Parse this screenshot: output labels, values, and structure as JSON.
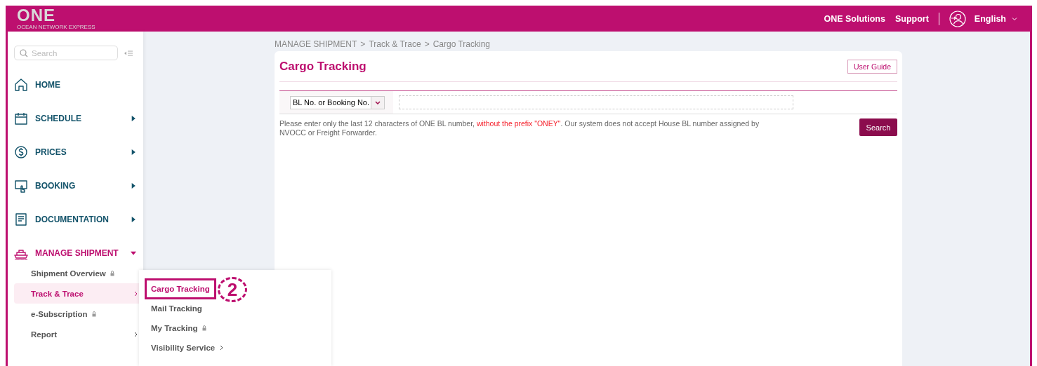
{
  "header": {
    "logo": "ONE",
    "logo_tagline": "OCEAN NETWORK EXPRESS",
    "links": [
      "ONE Solutions",
      "Support"
    ],
    "language": "English"
  },
  "sidebar": {
    "search": {
      "placeholder": "Search"
    },
    "items": [
      {
        "label": "HOME",
        "selected": false,
        "expandable": false,
        "expanded": false
      },
      {
        "label": "SCHEDULE",
        "selected": false,
        "expandable": true,
        "expanded": false
      },
      {
        "label": "PRICES",
        "selected": false,
        "expandable": true,
        "expanded": false
      },
      {
        "label": "BOOKING",
        "selected": false,
        "expandable": true,
        "expanded": false
      },
      {
        "label": "DOCUMENTATION",
        "selected": false,
        "expandable": true,
        "expanded": false
      },
      {
        "label": "MANAGE SHIPMENT",
        "selected": true,
        "expandable": true,
        "expanded": true,
        "children": [
          {
            "label": "Shipment Overview",
            "selected": false,
            "locked": true,
            "submenu": false
          },
          {
            "label": "Track & Trace",
            "selected": true,
            "locked": false,
            "submenu": true
          },
          {
            "label": "e-Subscription",
            "selected": false,
            "locked": true,
            "submenu": false
          },
          {
            "label": "Report",
            "selected": false,
            "locked": false,
            "submenu": true
          }
        ]
      }
    ]
  },
  "flyout": {
    "items": [
      {
        "label": "Cargo Tracking",
        "selected": true,
        "locked": false,
        "submenu": false,
        "highlighted": true
      },
      {
        "label": "Mail Tracking",
        "selected": false,
        "locked": false,
        "submenu": false,
        "highlighted": false
      },
      {
        "label": "My Tracking",
        "selected": false,
        "locked": true,
        "submenu": false,
        "highlighted": false
      },
      {
        "label": "Visibility Service",
        "selected": false,
        "locked": false,
        "submenu": true,
        "highlighted": false
      }
    ],
    "annotation": "2"
  },
  "breadcrumb": {
    "separator": ">",
    "items": [
      "MANAGE SHIPMENT",
      "Track & Trace",
      "Cargo Tracking"
    ]
  },
  "card": {
    "title": "Cargo Tracking",
    "user_guide": "User Guide",
    "select": "BL No. or Booking No.",
    "hint": [
      {
        "kind": "normal",
        "text": "Please enter only the last 12 characters of ONE BL number, "
      },
      {
        "kind": "warning",
        "text": "without the prefix \"ONEY\""
      },
      {
        "kind": "normal",
        "text": ". Our system does not accept House BL number assigned by NVOCC or Freight Forwarder."
      }
    ],
    "search_button": "Search"
  }
}
